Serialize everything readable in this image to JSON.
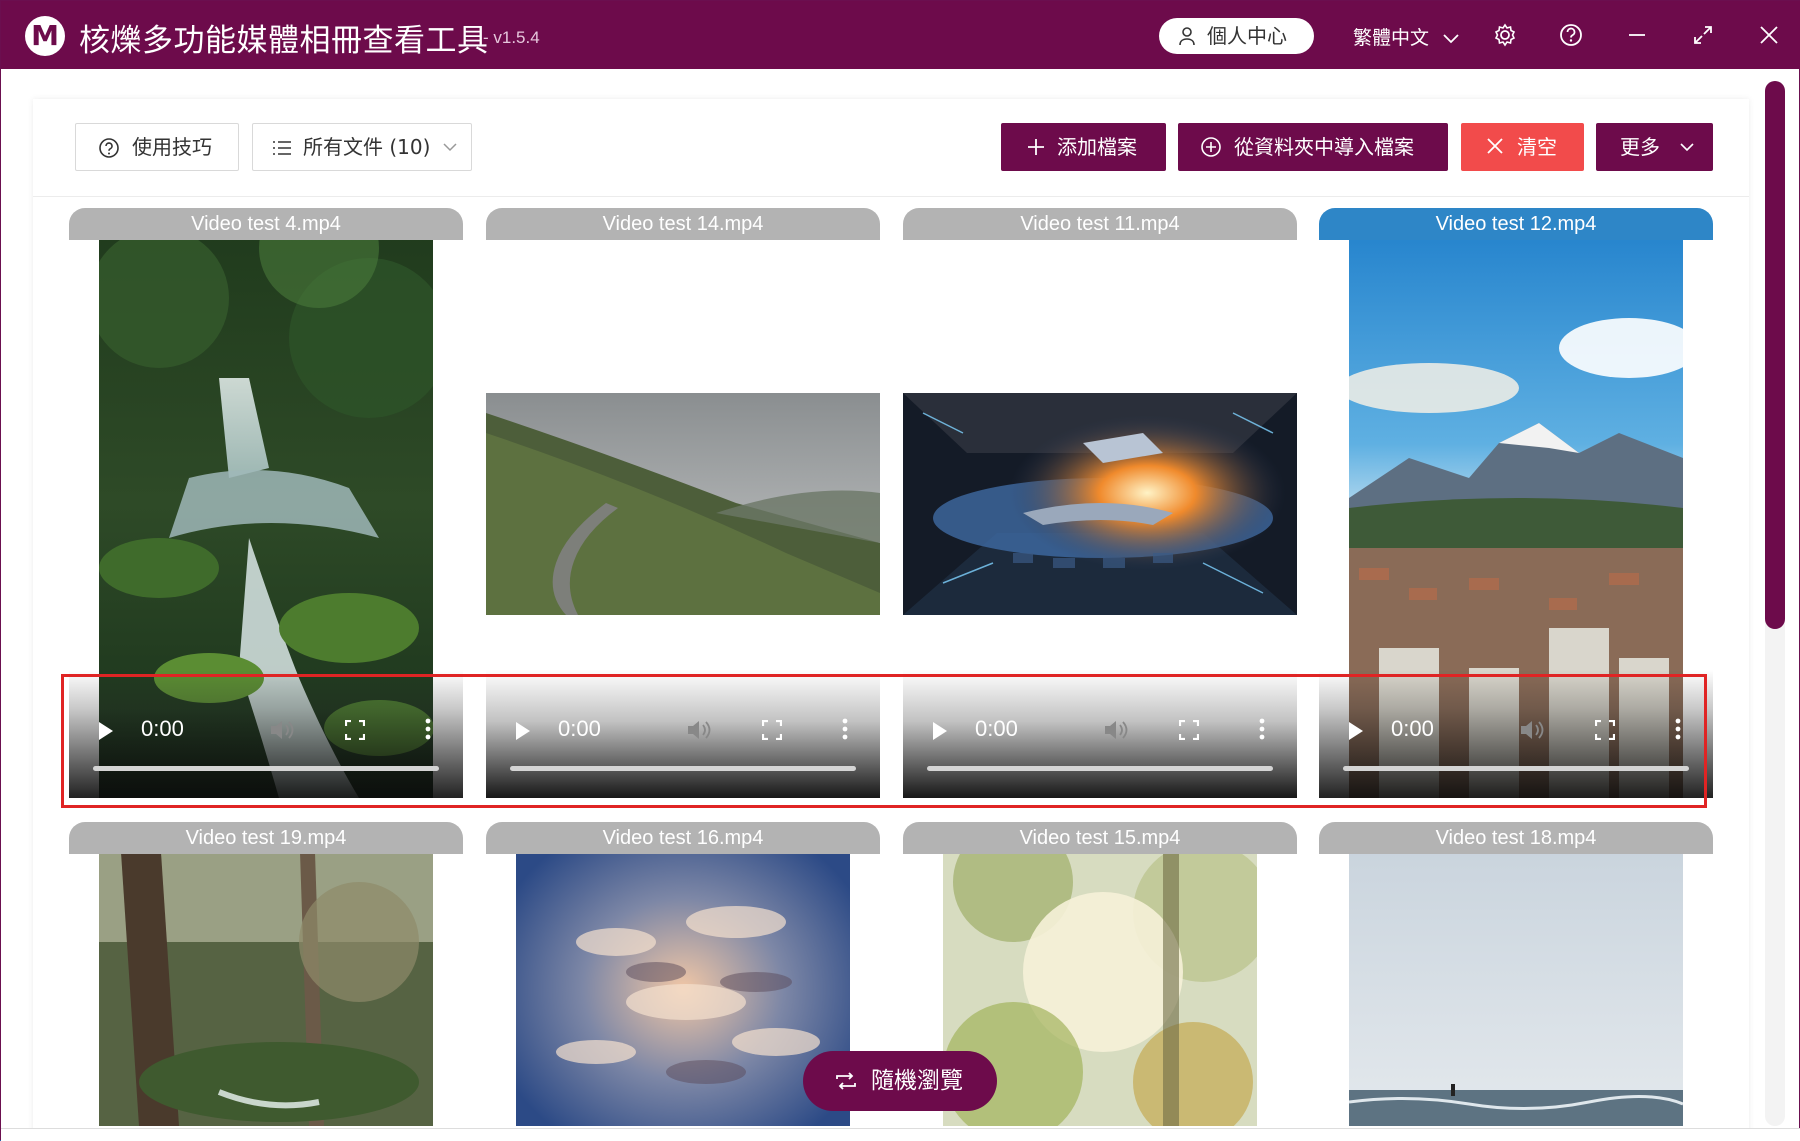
{
  "app": {
    "logo_letter": "M",
    "title": "核爍多功能媒體相冊查看工具",
    "version": "- v1.5.4",
    "brand_color": "#6d0b4b"
  },
  "titlebar": {
    "user_center": "個人中心",
    "language": "繁體中文",
    "icons": [
      "user-icon",
      "chevron-down-icon",
      "gear-icon",
      "help-icon",
      "minimize-icon",
      "maximize-icon",
      "close-icon"
    ]
  },
  "toolbar": {
    "tips": "使用技巧",
    "filter": "所有文件 (10)",
    "add_file": "添加檔案",
    "import_folder": "從資料夾中導入檔案",
    "clear": "清空",
    "more": "更多",
    "accent_color": "#6d0b4b",
    "danger_color": "#f24b4b"
  },
  "videos": [
    {
      "name": "Video test 4.mp4",
      "time": "0:00"
    },
    {
      "name": "Video test 14.mp4",
      "time": "0:00"
    },
    {
      "name": "Video test 11.mp4",
      "time": "0:00"
    },
    {
      "name": "Video test 12.mp4",
      "time": "0:00"
    },
    {
      "name": "Video test 19.mp4"
    },
    {
      "name": "Video test 16.mp4"
    },
    {
      "name": "Video test 15.mp4"
    },
    {
      "name": "Video test 18.mp4"
    }
  ],
  "random_browse": "隨機瀏覽"
}
